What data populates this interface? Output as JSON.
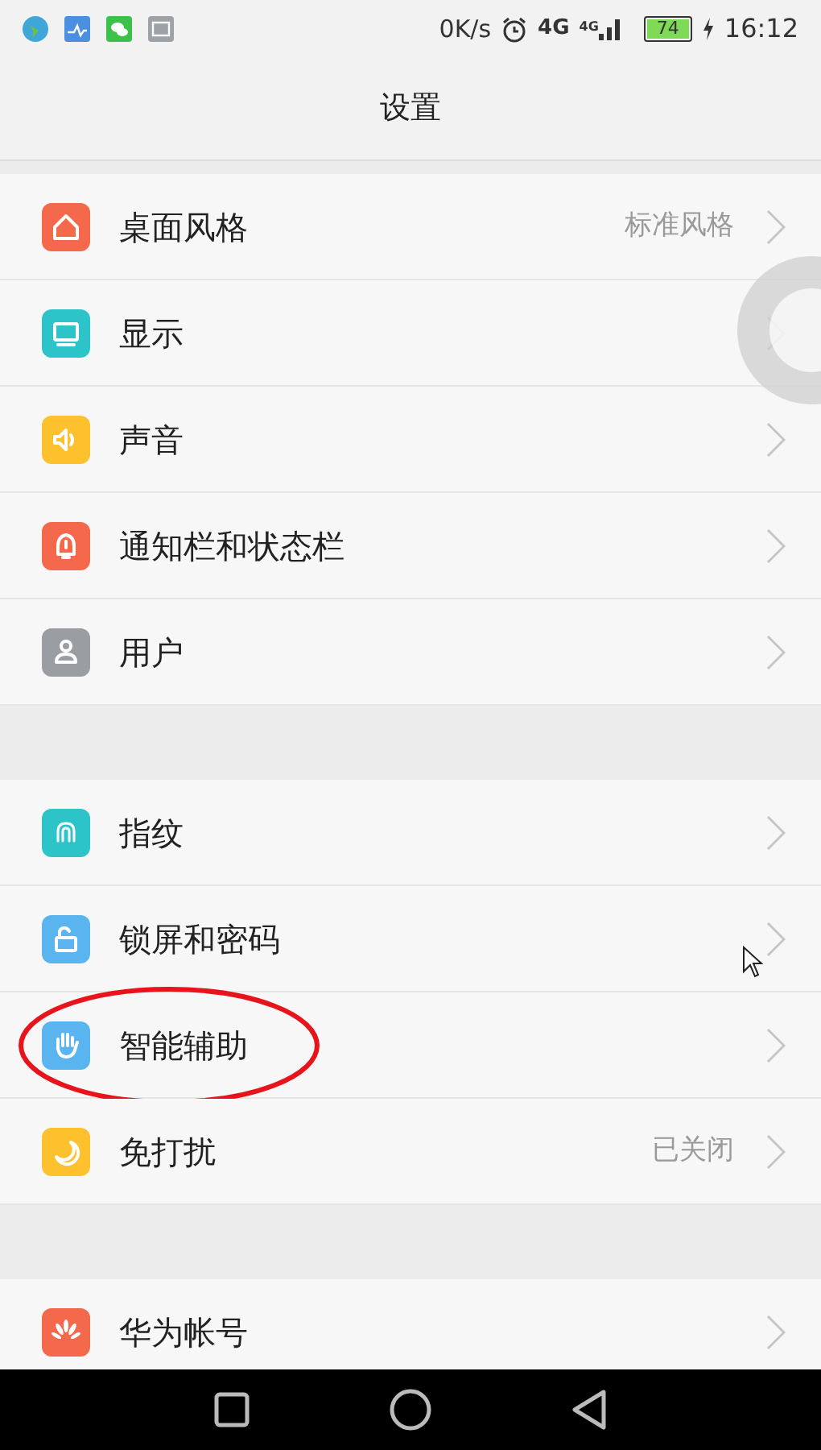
{
  "status_bar": {
    "net_speed": "0K/s",
    "network": "4G",
    "network_small": "4G",
    "battery": "74",
    "charging": true,
    "time": "16:12"
  },
  "title": "设置",
  "sections": [
    {
      "items": [
        {
          "kind": "home",
          "color": "#f4694b",
          "label": "桌面风格",
          "value": "标准风格"
        },
        {
          "kind": "display",
          "color": "#2cc4c9",
          "label": "显示"
        },
        {
          "kind": "sound",
          "color": "#fcc12d",
          "label": "声音"
        },
        {
          "kind": "bell",
          "color": "#f4694b",
          "label": "通知栏和状态栏"
        },
        {
          "kind": "user",
          "color": "#9a9ea3",
          "label": "用户"
        }
      ]
    },
    {
      "items": [
        {
          "kind": "fingerprint",
          "color": "#2cc4c9",
          "label": "指纹"
        },
        {
          "kind": "lock",
          "color": "#5ab4ef",
          "label": "锁屏和密码"
        },
        {
          "kind": "hand",
          "color": "#5ab4ef",
          "label": "智能辅助",
          "circled": true
        },
        {
          "kind": "moon",
          "color": "#fcc12d",
          "label": "免打扰",
          "value": "已关闭"
        }
      ]
    },
    {
      "items": [
        {
          "kind": "huawei",
          "color": "#f4694b",
          "label": "华为帐号"
        }
      ]
    }
  ]
}
